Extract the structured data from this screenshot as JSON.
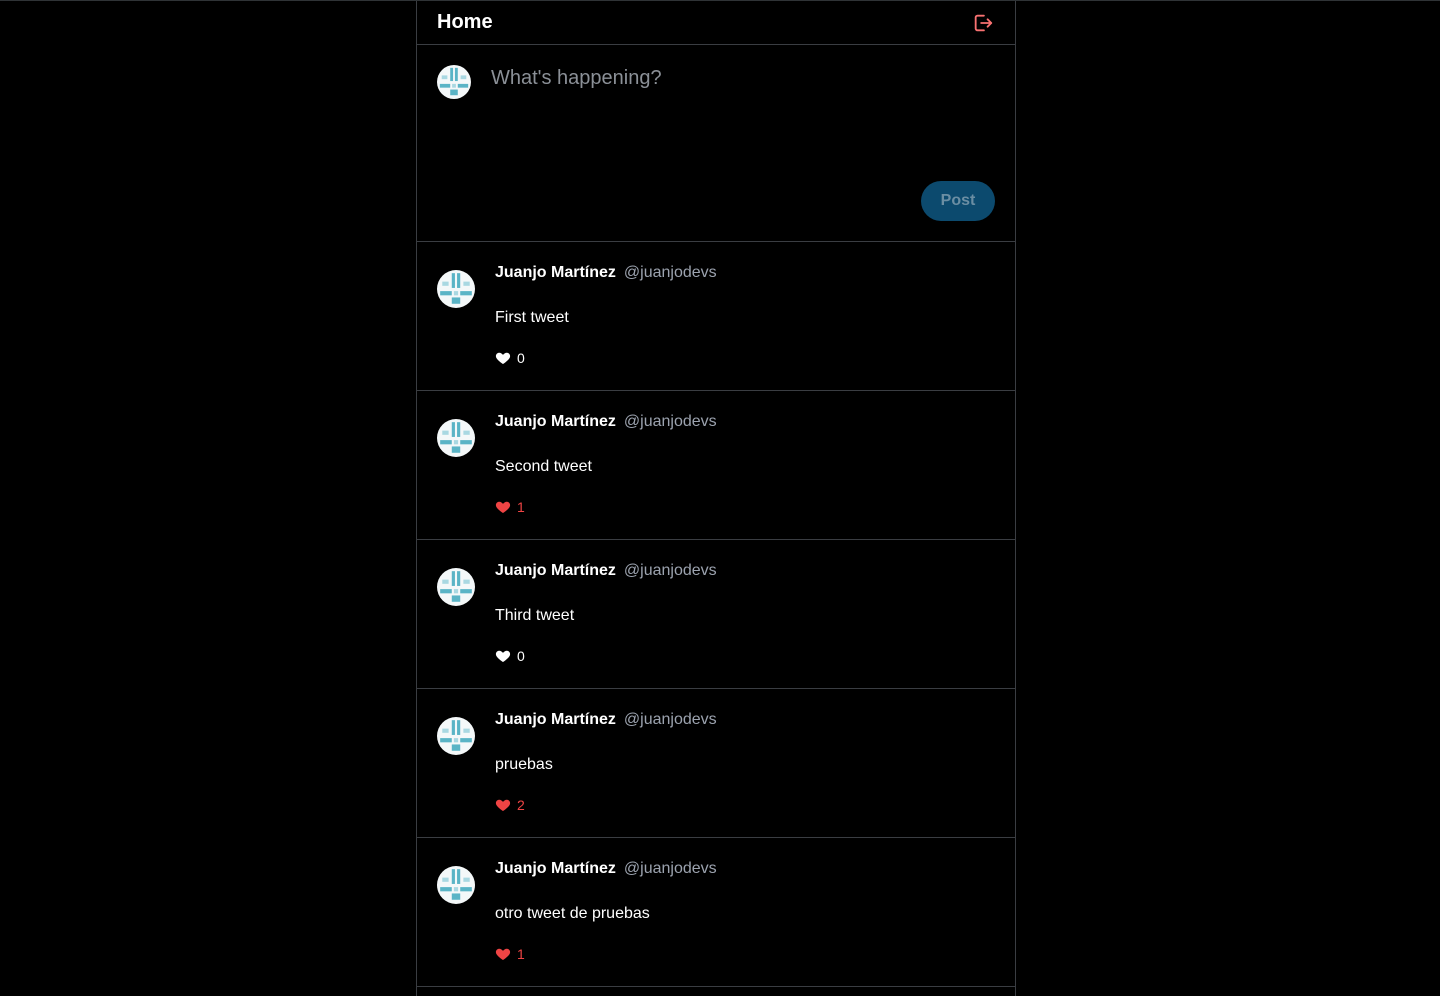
{
  "header": {
    "title": "Home",
    "logout_icon": "logout-icon",
    "logout_color": "#f87171"
  },
  "composer": {
    "placeholder": "What's happening?",
    "post_label": "Post",
    "post_color": "#0c4a6e"
  },
  "colors": {
    "background": "#000000",
    "border": "#3a3d42",
    "like_active": "#ef4444",
    "handle": "#9ca3af",
    "avatar_accent": "#6bbfcf"
  },
  "tweets": [
    {
      "name": "Juanjo Martínez",
      "handle": "@juanjodevs",
      "text": "First tweet",
      "likes": "0",
      "liked": false
    },
    {
      "name": "Juanjo Martínez",
      "handle": "@juanjodevs",
      "text": "Second tweet",
      "likes": "1",
      "liked": true
    },
    {
      "name": "Juanjo Martínez",
      "handle": "@juanjodevs",
      "text": "Third tweet",
      "likes": "0",
      "liked": false
    },
    {
      "name": "Juanjo Martínez",
      "handle": "@juanjodevs",
      "text": "pruebas",
      "likes": "2",
      "liked": true
    },
    {
      "name": "Juanjo Martínez",
      "handle": "@juanjodevs",
      "text": "otro tweet de pruebas",
      "likes": "1",
      "liked": true
    }
  ]
}
